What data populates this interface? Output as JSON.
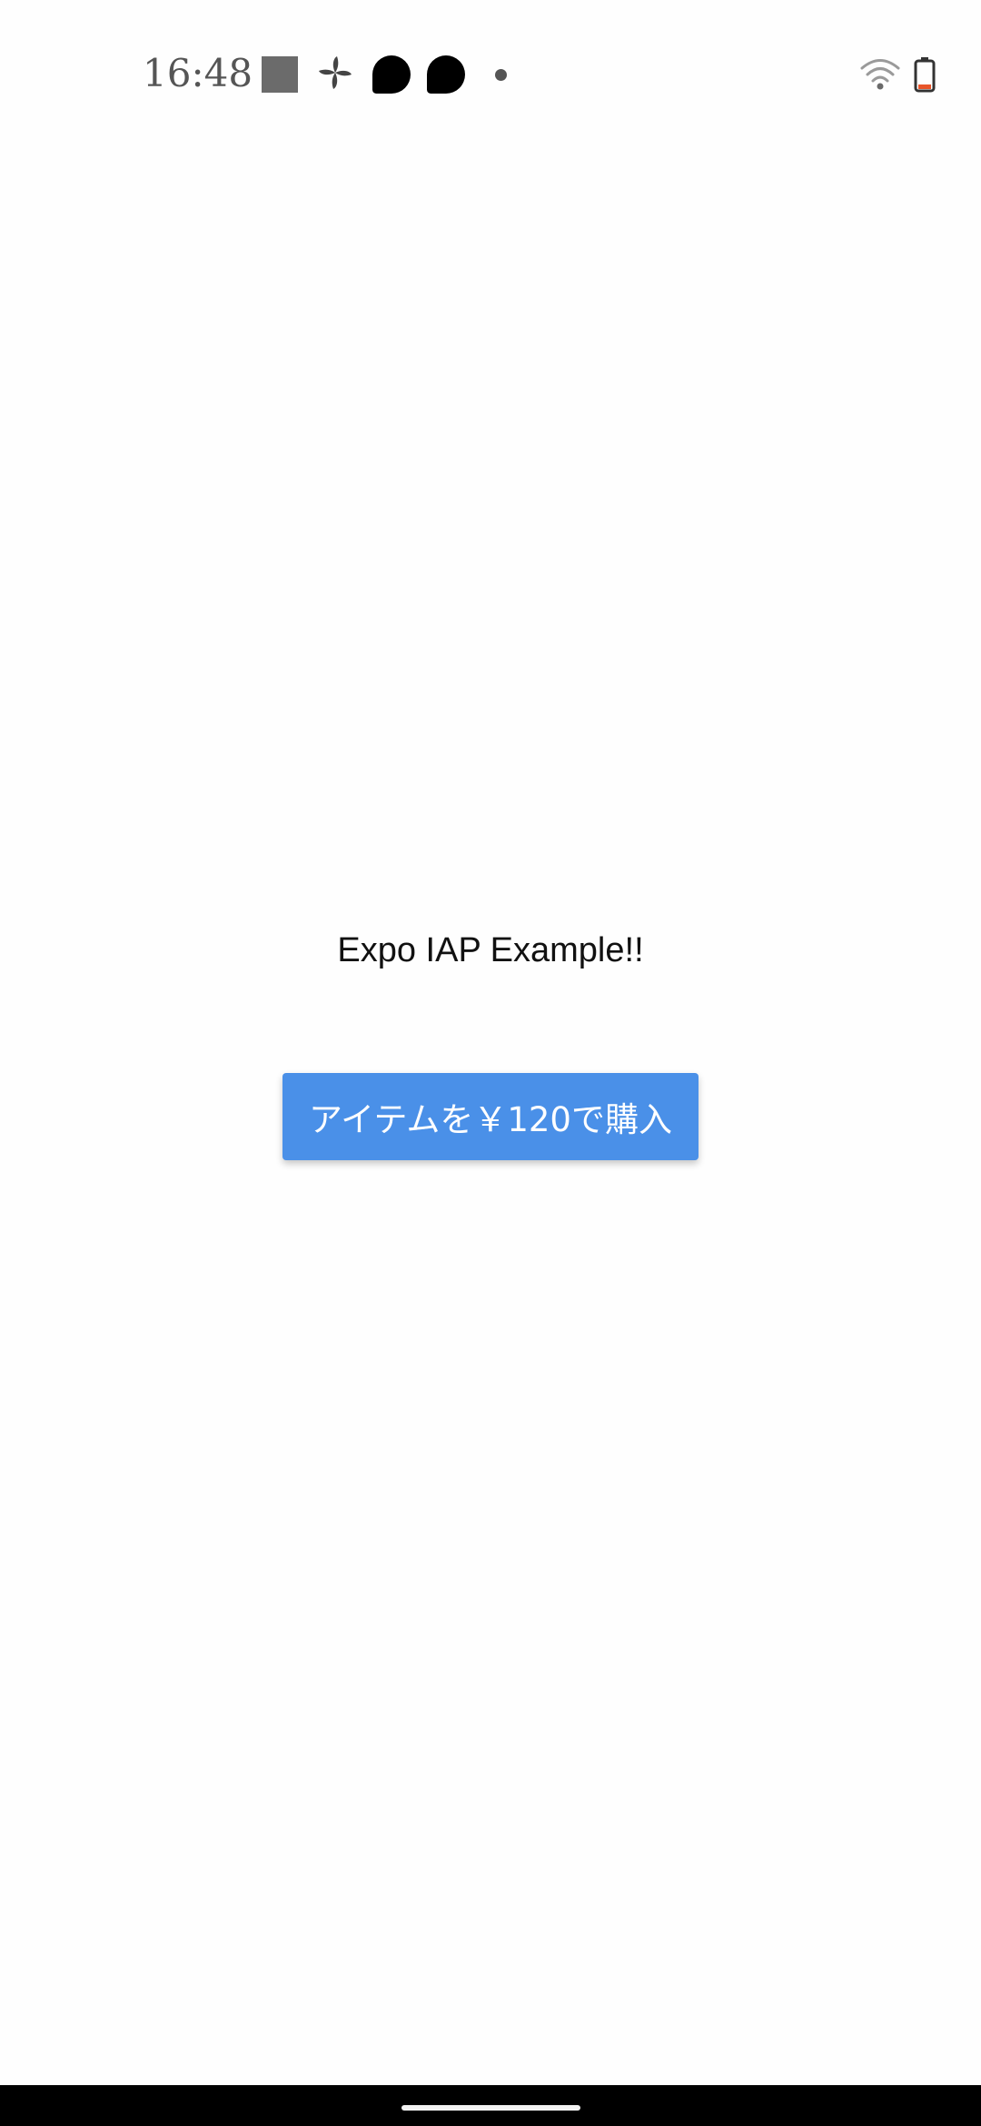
{
  "status_bar": {
    "time": "16:48",
    "notification_icons": [
      "square-icon",
      "pinwheel-icon",
      "blob-icon",
      "blob-icon",
      "dot-icon"
    ],
    "wifi_icon": "wifi-icon",
    "battery_icon": "battery-icon",
    "battery_level_color": "#e8552a"
  },
  "main": {
    "title": "Expo IAP Example!!",
    "buy_button_label": "アイテムを￥120で購入",
    "buy_button_color": "#4a90e8"
  },
  "nav_bar": {
    "handle_icon": "home-handle-icon"
  }
}
